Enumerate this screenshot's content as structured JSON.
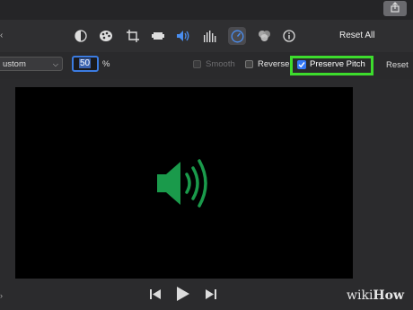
{
  "toolbar": {
    "icons": [
      "color-balance-icon",
      "color-correction-icon",
      "crop-icon",
      "stabilization-icon",
      "volume-icon",
      "equalizer-icon",
      "speed-icon",
      "clip-filter-icon",
      "info-icon"
    ],
    "active_icon": "speed-icon",
    "reset_all_label": "Reset All"
  },
  "options": {
    "preset_value": "ustom",
    "speed_value": "50",
    "percent_symbol": "%",
    "smooth_label": "Smooth",
    "reverse_label": "Reverse",
    "preserve_pitch_label": "Preserve Pitch",
    "preserve_pitch_checked": true,
    "reset_label": "Reset"
  },
  "viewer": {
    "content": "speaker-icon"
  },
  "colors": {
    "accent": "#3478f6",
    "highlight": "#3ddc2d",
    "speaker": "#1a9a4b"
  },
  "watermark": {
    "prefix": "wiki",
    "suffix": "How"
  }
}
